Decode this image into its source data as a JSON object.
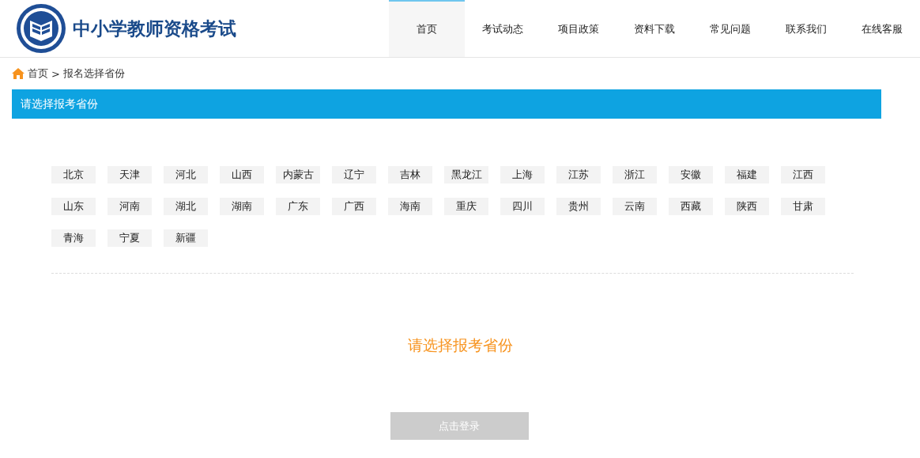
{
  "header": {
    "site_title": "中小学教师资格考试"
  },
  "nav": [
    {
      "label": "首页",
      "selected": true
    },
    {
      "label": "考试动态",
      "selected": false
    },
    {
      "label": "项目政策",
      "selected": false
    },
    {
      "label": "资料下载",
      "selected": false
    },
    {
      "label": "常见问题",
      "selected": false
    },
    {
      "label": "联系我们",
      "selected": false
    },
    {
      "label": "在线客服",
      "selected": false
    }
  ],
  "breadcrumb": {
    "home": "首页",
    "separator": ">",
    "current": "报名选择省份"
  },
  "section_title": "请选择报考省份",
  "provinces": [
    "北京",
    "天津",
    "河北",
    "山西",
    "内蒙古",
    "辽宁",
    "吉林",
    "黑龙江",
    "上海",
    "江苏",
    "浙江",
    "安徽",
    "福建",
    "江西",
    "山东",
    "河南",
    "湖北",
    "湖南",
    "广东",
    "广西",
    "海南",
    "重庆",
    "四川",
    "贵州",
    "云南",
    "西藏",
    "陕西",
    "甘肃",
    "青海",
    "宁夏",
    "新疆"
  ],
  "prompt": "请选择报考省份",
  "login_button": {
    "label": "点击登录",
    "disabled": true
  }
}
